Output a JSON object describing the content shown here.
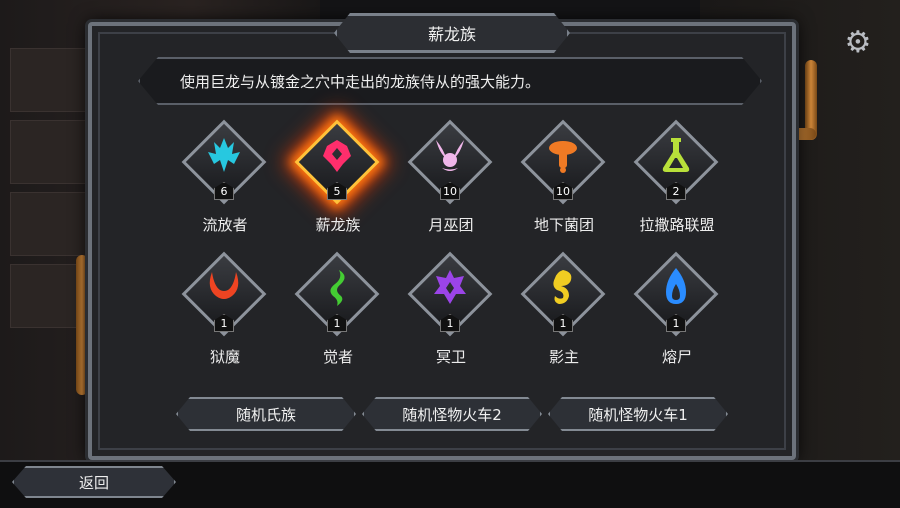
{
  "dialog": {
    "title": "薪龙族",
    "description": "使用巨龙与从镀金之穴中走出的龙族侍从的强大能力。"
  },
  "clans": [
    {
      "name": "流放者",
      "count": "6",
      "icon": "exiles-icon",
      "color": "#27c8e0",
      "selected": false
    },
    {
      "name": "薪龙族",
      "count": "5",
      "icon": "dragon-clan-icon",
      "color": "#ff2e6c",
      "selected": true
    },
    {
      "name": "月巫团",
      "count": "10",
      "icon": "moon-coven-icon",
      "color": "#f0b6ea",
      "selected": false
    },
    {
      "name": "地下菌团",
      "count": "10",
      "icon": "underground-fungus-icon",
      "color": "#f07a24",
      "selected": false
    },
    {
      "name": "拉撒路联盟",
      "count": "2",
      "icon": "lazarus-flask-icon",
      "color": "#b8e03a",
      "selected": false
    },
    {
      "name": "狱魔",
      "count": "1",
      "icon": "hellhorned-icon",
      "color": "#ee4422",
      "selected": false
    },
    {
      "name": "觉者",
      "count": "1",
      "icon": "awoken-icon",
      "color": "#44cc33",
      "selected": false
    },
    {
      "name": "冥卫",
      "count": "1",
      "icon": "stygian-icon",
      "color": "#9b44e8",
      "selected": false
    },
    {
      "name": "影主",
      "count": "1",
      "icon": "umbra-icon",
      "color": "#f0cc22",
      "selected": false
    },
    {
      "name": "熔尸",
      "count": "1",
      "icon": "melting-flame-icon",
      "color": "#2a8cff",
      "selected": false
    }
  ],
  "buttons": {
    "random_clan": "随机氏族",
    "random_train_2": "随机怪物火车2",
    "random_train_1": "随机怪物火车1",
    "back": "返回"
  },
  "colors": {
    "panel_border": "#6c727b",
    "selected_glow": "#ff7a12",
    "pipe_copper": "#d48a3a"
  }
}
